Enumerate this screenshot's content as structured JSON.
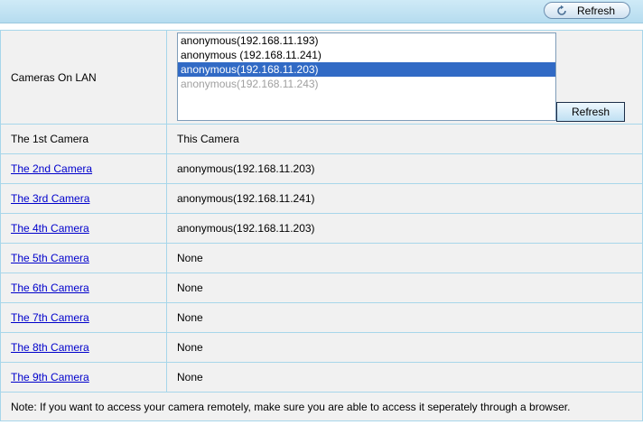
{
  "toolbar": {
    "refresh_label": "Refresh"
  },
  "lan": {
    "label": "Cameras On LAN",
    "options": [
      {
        "text": "anonymous(192.168.11.193)",
        "state": "normal"
      },
      {
        "text": "anonymous (192.168.11.241)",
        "state": "normal"
      },
      {
        "text": "anonymous(192.168.11.203)",
        "state": "selected"
      },
      {
        "text": "anonymous(192.168.11.243)",
        "state": "dim"
      }
    ],
    "refresh_label": "Refresh"
  },
  "cameras": [
    {
      "label": "The 1st Camera",
      "value": "This Camera"
    },
    {
      "label": "The 2nd Camera",
      "value": "anonymous(192.168.11.203)"
    },
    {
      "label": "The 3rd Camera",
      "value": "anonymous(192.168.11.241)"
    },
    {
      "label": "The 4th Camera",
      "value": "anonymous(192.168.11.203)"
    },
    {
      "label": "The 5th Camera",
      "value": "None"
    },
    {
      "label": "The 6th Camera",
      "value": "None"
    },
    {
      "label": "The 7th Camera",
      "value": "None"
    },
    {
      "label": "The 8th Camera",
      "value": "None"
    },
    {
      "label": "The 9th Camera",
      "value": "None"
    }
  ],
  "note": "Note: If you want to access your camera remotely, make sure you are able to access it seperately through a browser.",
  "colors": {
    "accent": "#316ac5",
    "link": "#0000cc",
    "border": "#a7d6ea"
  },
  "icons": {
    "refresh": "refresh-icon"
  }
}
